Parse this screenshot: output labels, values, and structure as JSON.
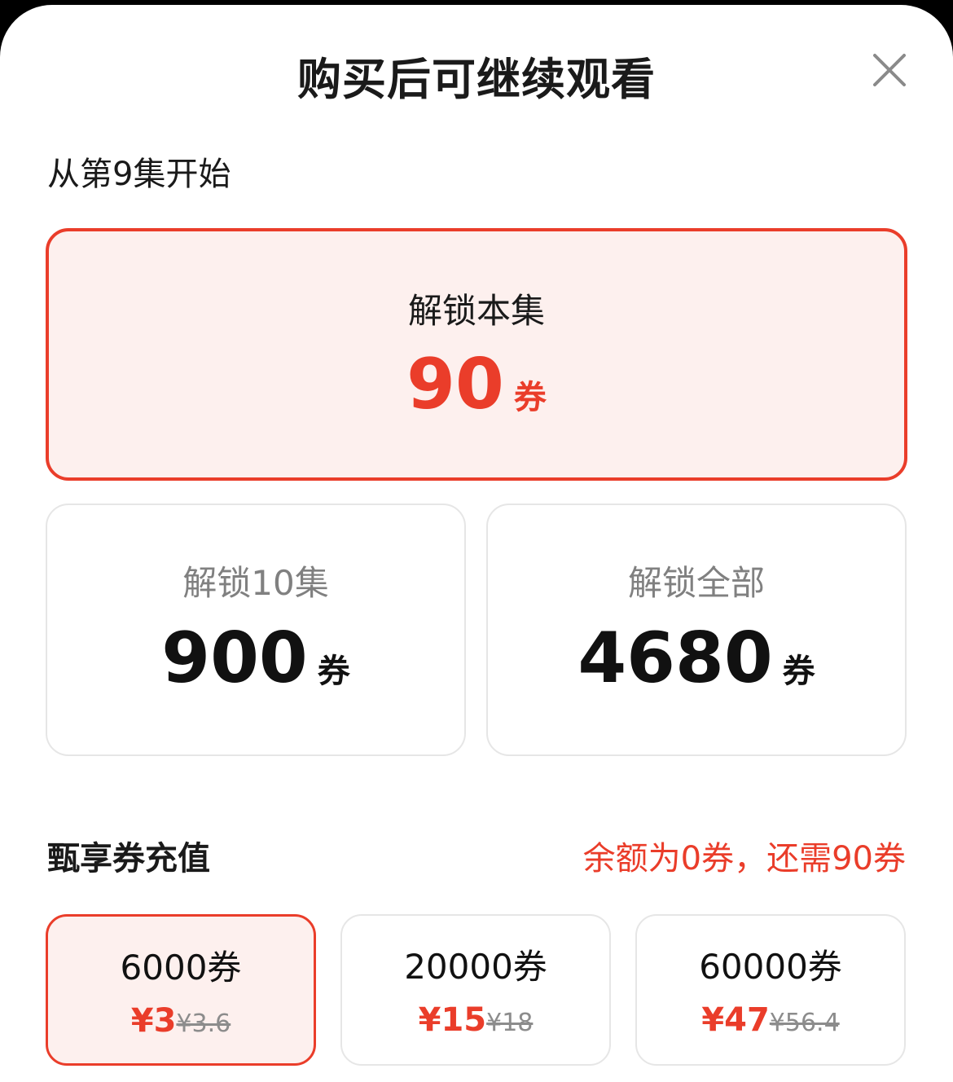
{
  "header": {
    "title": "购买后可继续观看"
  },
  "subtitle": "从第9集开始",
  "unlock_options": [
    {
      "label": "解锁本集",
      "price": "90",
      "unit": "券",
      "selected": true
    },
    {
      "label": "解锁10集",
      "price": "900",
      "unit": "券",
      "selected": false
    },
    {
      "label": "解锁全部",
      "price": "4680",
      "unit": "券",
      "selected": false
    }
  ],
  "recharge": {
    "title": "甄享券充值",
    "balance_text": "余额为0券，还需90券",
    "packages": [
      {
        "amount": "6000券",
        "price": "¥3",
        "original_price": "¥3.6",
        "selected": true
      },
      {
        "amount": "20000券",
        "price": "¥15",
        "original_price": "¥18",
        "selected": false
      },
      {
        "amount": "60000券",
        "price": "¥47",
        "original_price": "¥56.4",
        "selected": false
      }
    ]
  },
  "colors": {
    "accent": "#ea3d2a",
    "selected_bg": "#fdf0ee",
    "border": "#e6e6e6"
  }
}
